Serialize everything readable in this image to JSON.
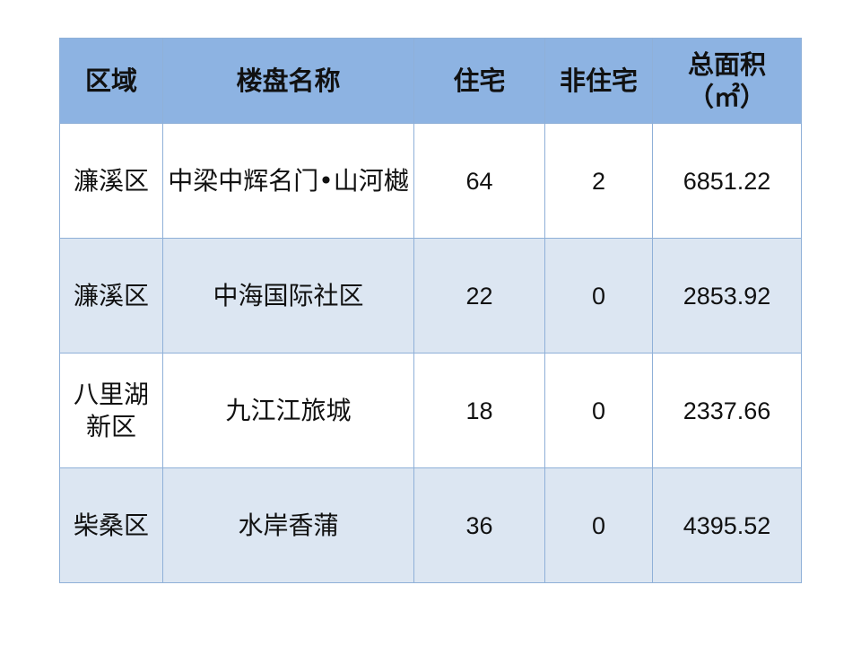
{
  "table": {
    "headers": {
      "district": "区域",
      "project": "楼盘名称",
      "residential": "住宅",
      "non_residential": "非住宅",
      "area_line1": "总面积",
      "area_line2": "（㎡）"
    },
    "rows": [
      {
        "district": "濂溪区",
        "project": "中梁中辉名门•山河樾",
        "residential": "64",
        "non_residential": "2",
        "area": "6851.22"
      },
      {
        "district": "濂溪区",
        "project": "中海国际社区",
        "residential": "22",
        "non_residential": "0",
        "area": "2853.92"
      },
      {
        "district": "八里湖新区",
        "project": "九江江旅城",
        "residential": "18",
        "non_residential": "0",
        "area": "2337.66"
      },
      {
        "district": "柴桑区",
        "project": "水岸香蒲",
        "residential": "36",
        "non_residential": "0",
        "area": "4395.52"
      }
    ],
    "colors": {
      "header_bg": "#8db3e2",
      "row_alt_bg": "#dce6f2",
      "border": "#8fb0d8"
    }
  }
}
